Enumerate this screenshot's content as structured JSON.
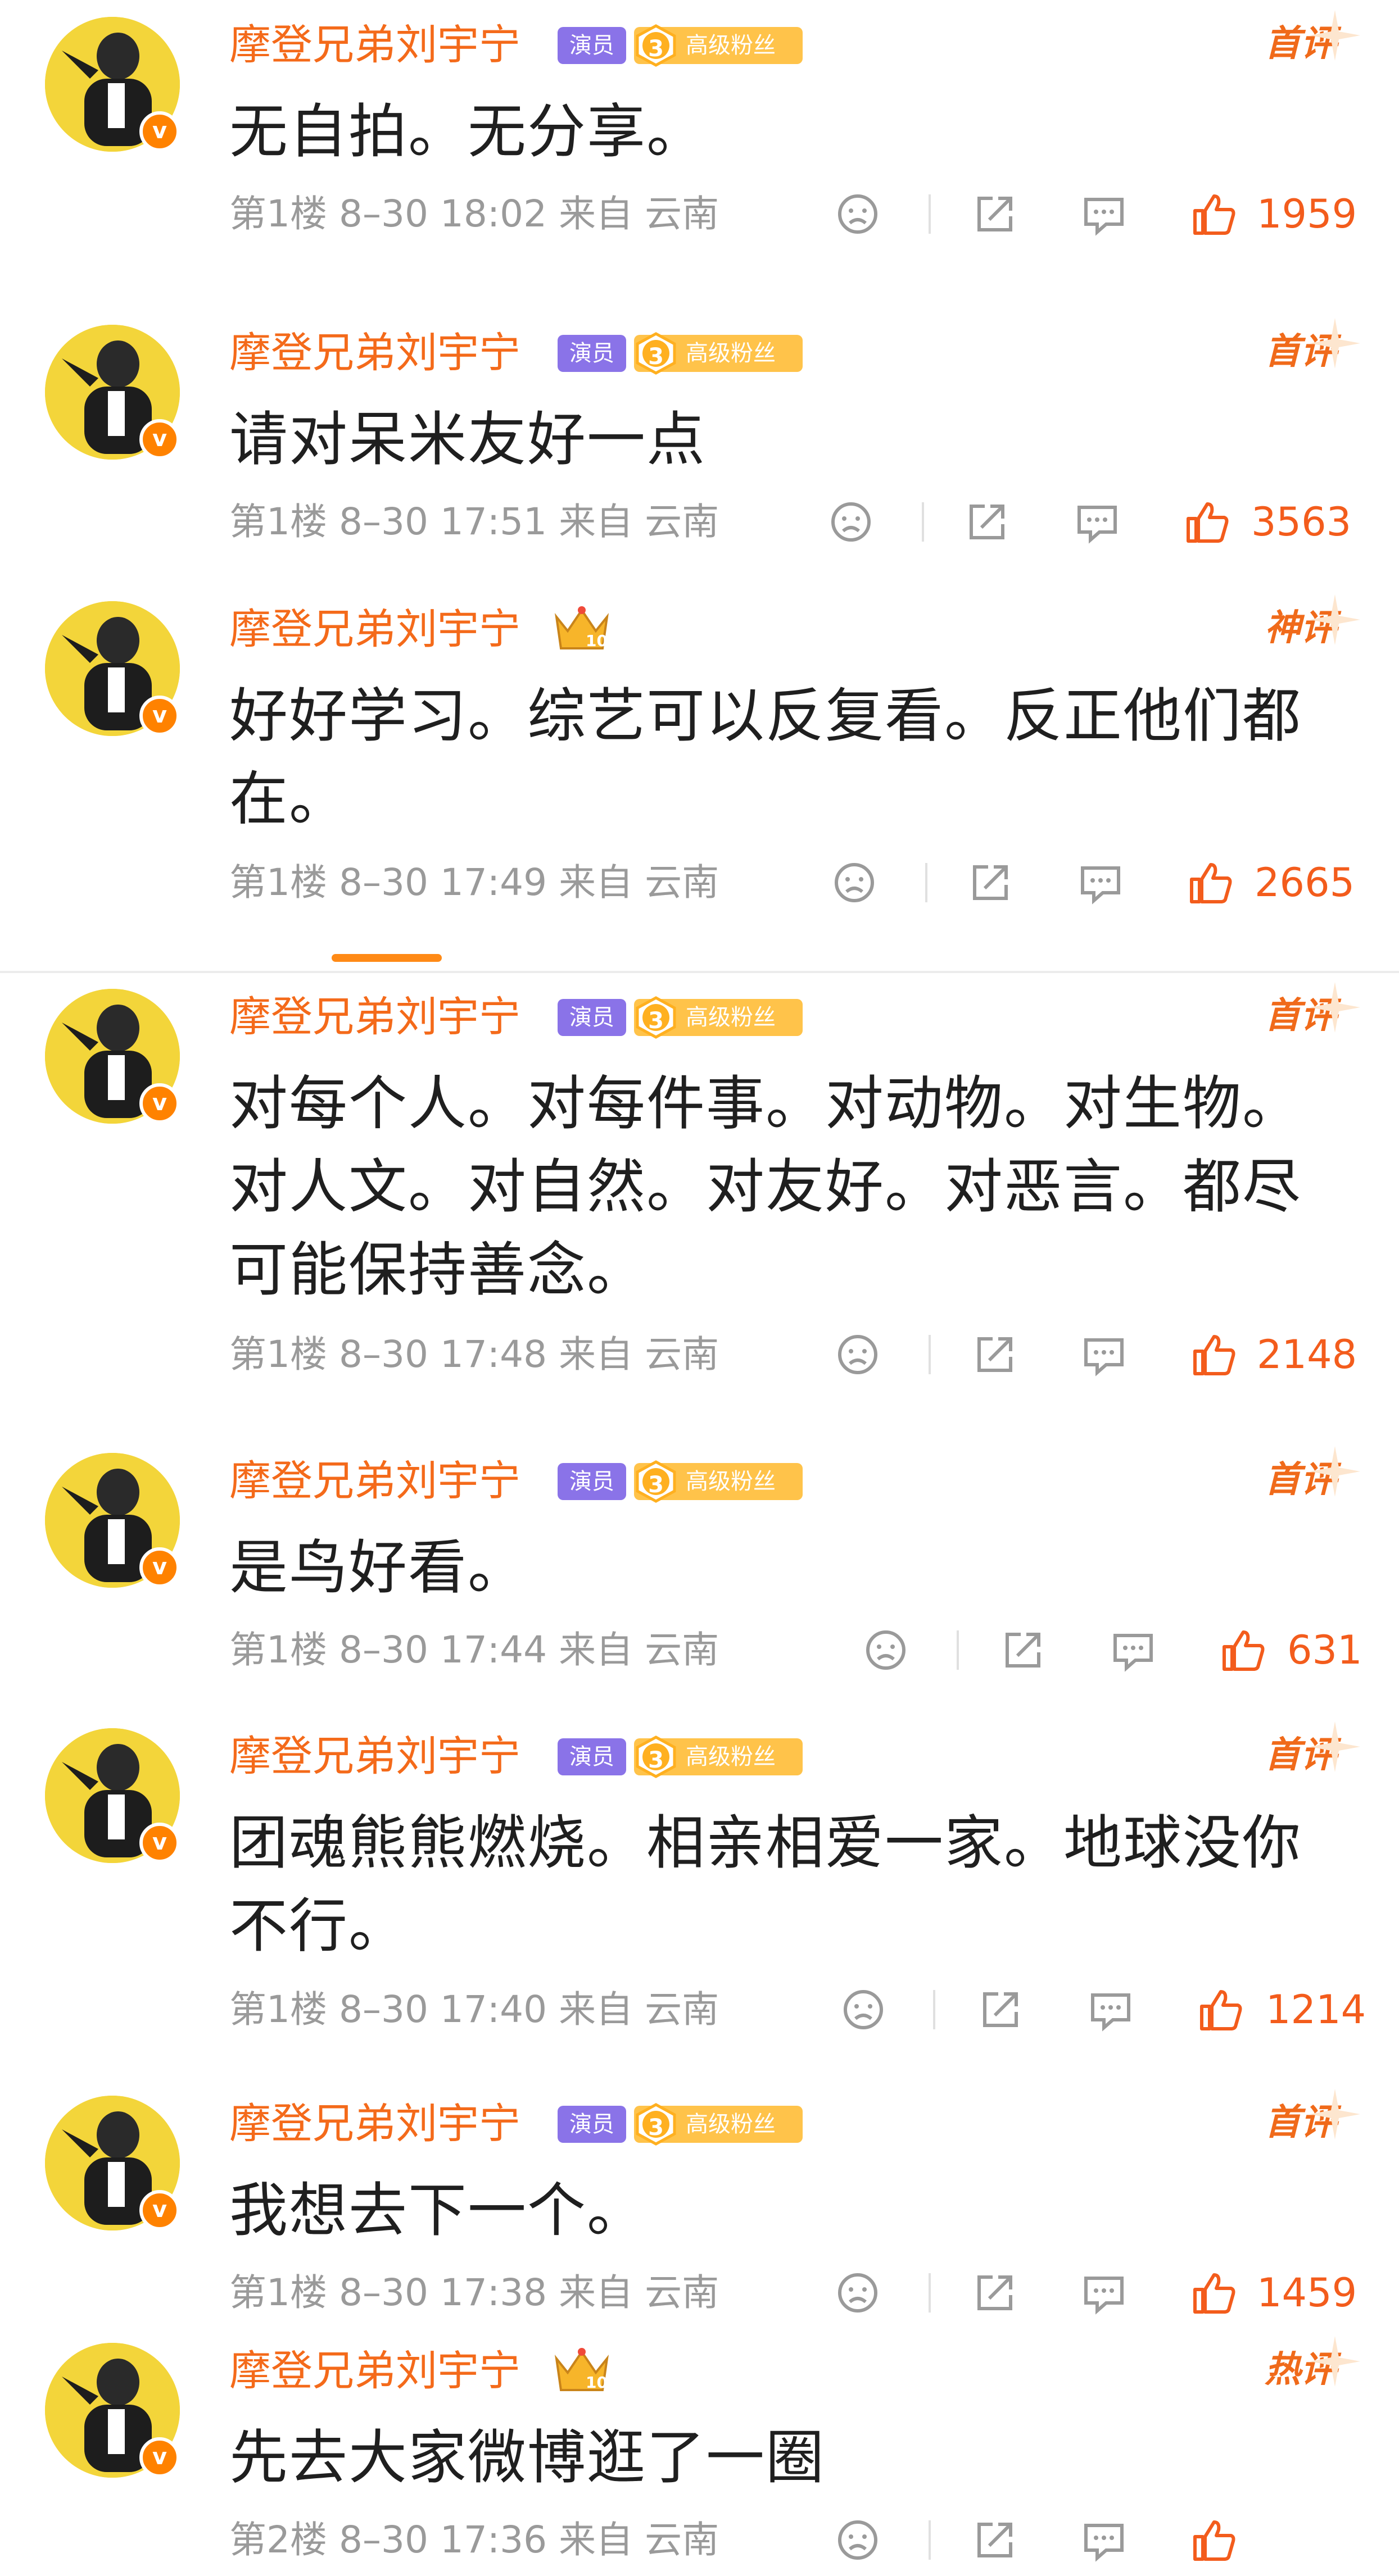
{
  "colors": {
    "accent": "#f46a1a",
    "like": "#f35c1c",
    "role_badge": "#8a73e8",
    "fan_badge": "#ffc34a"
  },
  "comments": [
    {
      "user": "摩登兄弟刘宇宁",
      "role_tag": "演员",
      "fan_level": "3",
      "fan_tag": "高级粉丝",
      "crown": false,
      "rank": "首评",
      "text": "无自拍。无分享。",
      "meta": "第1楼 8–30 18:02 来自 云南",
      "likes": "1959"
    },
    {
      "user": "摩登兄弟刘宇宁",
      "role_tag": "演员",
      "fan_level": "3",
      "fan_tag": "高级粉丝",
      "crown": false,
      "rank": "首评",
      "text": "请对呆米友好一点",
      "meta": "第1楼 8–30 17:51 来自 云南",
      "likes": "3563"
    },
    {
      "user": "摩登兄弟刘宇宁",
      "role_tag": "",
      "fan_level": "",
      "fan_tag": "",
      "crown": true,
      "crown_level": "10",
      "rank": "神评",
      "text": "好好学习。综艺可以反复看。反正他们都在。",
      "meta": "第1楼 8–30 17:49 来自 云南",
      "likes": "2665"
    },
    {
      "user": "摩登兄弟刘宇宁",
      "role_tag": "演员",
      "fan_level": "3",
      "fan_tag": "高级粉丝",
      "crown": false,
      "rank": "首评",
      "text": "对每个人。对每件事。对动物。对生物。对人文。对自然。对友好。对恶言。都尽可能保持善念。",
      "meta": "第1楼 8–30 17:48 来自 云南",
      "likes": "2148"
    },
    {
      "user": "摩登兄弟刘宇宁",
      "role_tag": "演员",
      "fan_level": "3",
      "fan_tag": "高级粉丝",
      "crown": false,
      "rank": "首评",
      "text": "是鸟好看。",
      "meta": "第1楼 8–30 17:44 来自 云南",
      "likes": "631"
    },
    {
      "user": "摩登兄弟刘宇宁",
      "role_tag": "演员",
      "fan_level": "3",
      "fan_tag": "高级粉丝",
      "crown": false,
      "rank": "首评",
      "text": "团魂熊熊燃烧。相亲相爱一家。地球没你不行。",
      "meta": "第1楼 8–30 17:40 来自 云南",
      "likes": "1214"
    },
    {
      "user": "摩登兄弟刘宇宁",
      "role_tag": "演员",
      "fan_level": "3",
      "fan_tag": "高级粉丝",
      "crown": false,
      "rank": "首评",
      "text": "我想去下一个。",
      "meta": "第1楼 8–30 17:38 来自 云南",
      "likes": "1459"
    },
    {
      "user": "摩登兄弟刘宇宁",
      "role_tag": "",
      "fan_level": "",
      "fan_tag": "",
      "crown": true,
      "crown_level": "10",
      "rank": "热评",
      "text": "先去大家微博逛了一圈",
      "meta": "第2楼 8–30 17:36 来自 云南",
      "likes": ""
    }
  ]
}
